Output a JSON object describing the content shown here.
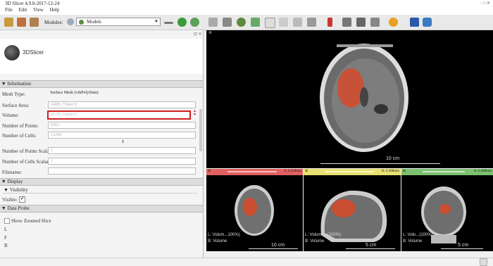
{
  "window": {
    "title": "3D Slicer 4.9.0-2017-12-24",
    "controls": "−  □  ✕"
  },
  "menu": [
    "File",
    "Edit",
    "View",
    "Help"
  ],
  "toolbar": {
    "modules_label": "Modules:",
    "module_selected": "Models"
  },
  "logo": {
    "text": "3DSlicer"
  },
  "sections": {
    "information": "Information",
    "display": "Display",
    "visibility": "Visibility",
    "data_probe": "Data Probe"
  },
  "information": {
    "mesh_type_label": "Mesh Type:",
    "mesh_type_value": "Surface Mesh (vtkPolyData)",
    "surface_area_label": "Surface Area:",
    "surface_area_value": "14081.75mm^2",
    "volume_label": "Volume:",
    "volume_value": "41797.14mm^3",
    "points_label": "Number of Points:",
    "points_value": "6362",
    "cells_label": "Number of Cells:",
    "cells_value": "12284",
    "point_scalars_label": "Number of Points Scalars:",
    "point_scalars_value": "1",
    "cell_scalars_label": "Number of Cells Scalars:",
    "cell_scalars_value": "1",
    "filename_label": "Filename:",
    "filename_value": ""
  },
  "visibility": {
    "label": "Visible:",
    "checked": "✔"
  },
  "data_probe": {
    "zoom_label": "Show Zoomed Slice",
    "l": "L",
    "f": "F",
    "b": "B"
  },
  "views": {
    "main_scale": "10 cm",
    "red_bar": "S: 0.250mm",
    "yellow_bar": "R: 0.488mm",
    "green_bar": "A: 0.488mm",
    "red_scale": "10 cm",
    "yellow_scale": "5 cm",
    "green_scale": "5 cm",
    "red_l1": "L: Volum...100%)",
    "red_l2": "B: Volume",
    "yellow_l1": "L: Volume...(100%)",
    "yellow_l2": "B: Volume",
    "green_l1": "L: Volu...(100%)",
    "green_l2": "B: Volume"
  }
}
